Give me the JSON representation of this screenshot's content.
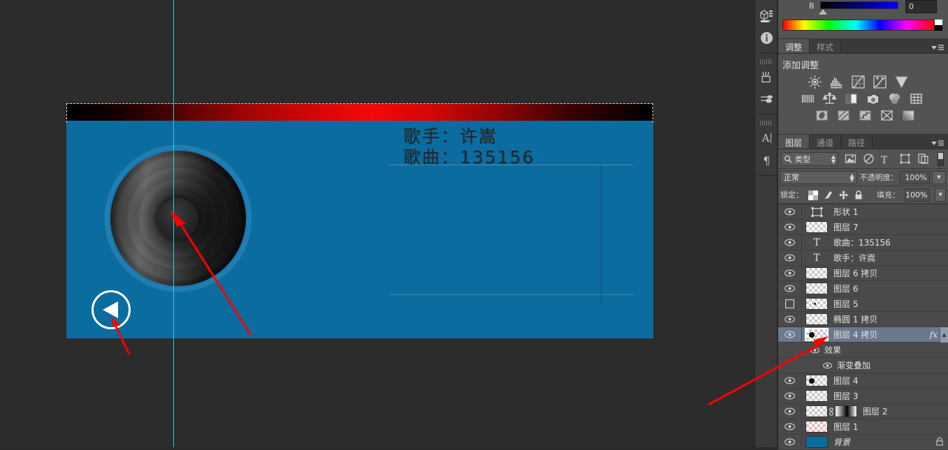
{
  "app": {
    "title": "Adobe Photoshop"
  },
  "canvas": {
    "artist_text": "歌手：许嵩",
    "song_text": "歌曲：135156",
    "background_color": "#0b6ca0",
    "strip_color": "#f40808",
    "guide_color": "#32cbd8",
    "annotation_color": "#ff0000",
    "back_button_label": "back-arrow"
  },
  "icon_rail": {
    "items": [
      {
        "name": "mini-bridge-icon"
      },
      {
        "name": "info-icon"
      },
      {
        "name": "brush-icon"
      },
      {
        "name": "brush-presets-icon"
      },
      {
        "name": "character-icon",
        "glyph": "A"
      },
      {
        "name": "paragraph-icon",
        "glyph": "¶"
      }
    ]
  },
  "color_panel": {
    "channel_label": "B",
    "channel_value": "0",
    "slider_from": "#000000",
    "slider_to": "#0000ff"
  },
  "adjustments_panel": {
    "tabs": [
      {
        "label": "调整",
        "active": true
      },
      {
        "label": "样式",
        "active": false
      }
    ],
    "title": "添加调整",
    "rows": [
      [
        {
          "name": "brightness-contrast-icon"
        },
        {
          "name": "levels-icon"
        },
        {
          "name": "curves-icon"
        },
        {
          "name": "exposure-icon"
        },
        {
          "name": "vibrance-icon"
        }
      ],
      [
        {
          "name": "hue-saturation-icon"
        },
        {
          "name": "color-balance-icon"
        },
        {
          "name": "black-white-icon"
        },
        {
          "name": "photo-filter-icon"
        },
        {
          "name": "channel-mixer-icon"
        },
        {
          "name": "color-lookup-icon"
        }
      ],
      [
        {
          "name": "invert-icon"
        },
        {
          "name": "posterize-icon"
        },
        {
          "name": "threshold-icon"
        },
        {
          "name": "selective-color-icon"
        },
        {
          "name": "gradient-map-icon"
        }
      ]
    ]
  },
  "layers_panel": {
    "tabs": [
      {
        "label": "图层",
        "active": true
      },
      {
        "label": "通道",
        "active": false
      },
      {
        "label": "路径",
        "active": false
      }
    ],
    "filter": {
      "type_label": "类型",
      "icons": [
        {
          "name": "filter-pixel-icon"
        },
        {
          "name": "filter-adjustment-icon"
        },
        {
          "name": "filter-type-icon"
        },
        {
          "name": "filter-shape-icon"
        },
        {
          "name": "filter-smart-object-icon"
        }
      ]
    },
    "blend_mode": "正常",
    "opacity_label": "不透明度：",
    "opacity_value": "100%",
    "lock_label": "锁定：",
    "fill_label": "填充：",
    "fill_value": "100%",
    "lock_icons": [
      {
        "name": "lock-transparency-icon"
      },
      {
        "name": "lock-image-icon"
      },
      {
        "name": "lock-position-icon"
      },
      {
        "name": "lock-all-icon"
      }
    ],
    "layers": [
      {
        "name": "形状 1",
        "thumb": "shape",
        "visible": true,
        "selected": false,
        "kind": "shape"
      },
      {
        "name": "图层 7",
        "thumb": "checker",
        "visible": true,
        "selected": false,
        "kind": "raster"
      },
      {
        "name": "歌曲：135156",
        "thumb": "type",
        "visible": true,
        "selected": false,
        "kind": "text"
      },
      {
        "name": "歌手：许嵩",
        "thumb": "type",
        "visible": true,
        "selected": false,
        "kind": "text"
      },
      {
        "name": "图层 6 拷贝",
        "thumb": "checker",
        "visible": true,
        "selected": false,
        "kind": "raster"
      },
      {
        "name": "图层 6",
        "thumb": "checker",
        "visible": true,
        "selected": false,
        "kind": "raster"
      },
      {
        "name": "图层 5",
        "thumb": "checker",
        "visible": false,
        "selected": false,
        "kind": "raster"
      },
      {
        "name": "椭圆 1 拷贝",
        "thumb": "checker",
        "visible": true,
        "selected": false,
        "kind": "raster"
      },
      {
        "name": "图层 4 拷贝",
        "thumb": "checker-dot",
        "visible": true,
        "selected": true,
        "kind": "raster",
        "fx": "fx"
      },
      {
        "name": "图层 4",
        "thumb": "checker-dot",
        "visible": true,
        "selected": false,
        "kind": "raster"
      },
      {
        "name": "图层 3",
        "thumb": "checker",
        "visible": true,
        "selected": false,
        "kind": "raster"
      },
      {
        "name": "图层 2",
        "thumb": "checker-mask",
        "visible": true,
        "selected": false,
        "kind": "raster"
      },
      {
        "name": "图层 1",
        "thumb": "checker-red",
        "visible": true,
        "selected": false,
        "kind": "raster"
      },
      {
        "name": "背景",
        "thumb": "blue",
        "visible": true,
        "selected": false,
        "kind": "background",
        "locked": true
      }
    ],
    "effects_group_label": "效果",
    "effect_item_label": "渐变叠加"
  }
}
